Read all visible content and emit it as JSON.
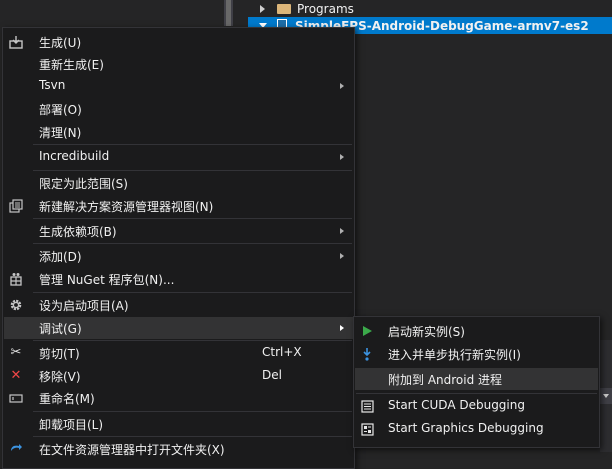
{
  "solution_explorer": {
    "rows": [
      {
        "label": "Programs",
        "expanded": false
      },
      {
        "label": "SimpleFPS-Android-DebugGame-armv7-es2",
        "expanded": true,
        "selected": true
      }
    ]
  },
  "context_menu": {
    "items": [
      {
        "label": "生成(U)",
        "icon": "build-icon"
      },
      {
        "label": "重新生成(E)"
      },
      {
        "label": "Tsvn",
        "submenu": true
      },
      {
        "label": "部署(O)"
      },
      {
        "label": "清理(N)"
      },
      {
        "label": "Incredibuild",
        "submenu": true
      },
      {
        "label": "限定为此范围(S)"
      },
      {
        "label": "新建解决方案资源管理器视图(N)",
        "icon": "new-view-icon"
      },
      {
        "label": "生成依赖项(B)",
        "submenu": true
      },
      {
        "label": "添加(D)",
        "submenu": true
      },
      {
        "label": "管理 NuGet 程序包(N)...",
        "icon": "nuget-icon"
      },
      {
        "label": "设为启动项目(A)",
        "icon": "gear-icon"
      },
      {
        "label": "调试(G)",
        "submenu": true,
        "active": true
      },
      {
        "label": "剪切(T)",
        "shortcut": "Ctrl+X",
        "icon": "scissors-icon"
      },
      {
        "label": "移除(V)",
        "shortcut": "Del",
        "icon": "remove-icon"
      },
      {
        "label": "重命名(M)",
        "icon": "rename-icon"
      },
      {
        "label": "卸载项目(L)"
      },
      {
        "label": "在文件资源管理器中打开文件夹(X)",
        "icon": "open-folder-icon"
      }
    ]
  },
  "debug_submenu": {
    "items": [
      {
        "label": "启动新实例(S)",
        "icon": "start-icon"
      },
      {
        "label": "进入并单步执行新实例(I)",
        "icon": "step-into-icon"
      },
      {
        "label": "附加到 Android 进程",
        "hover": true
      },
      {
        "label": "Start CUDA Debugging",
        "icon": "cuda-icon"
      },
      {
        "label": "Start Graphics Debugging",
        "icon": "graphics-debug-icon"
      }
    ]
  },
  "colors": {
    "menu_background": "#1b1b1c",
    "selection_blue": "#007acc",
    "hover_background": "#333334",
    "text": "#f1f1f1"
  }
}
